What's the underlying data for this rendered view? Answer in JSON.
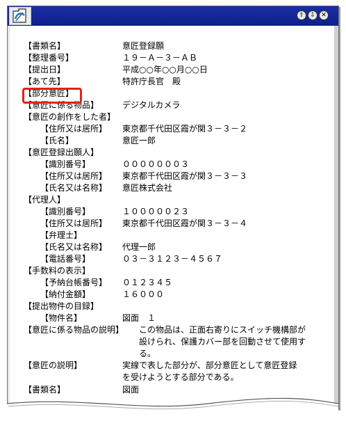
{
  "window": {
    "controls": [
      "⇧",
      "⇩",
      "✕"
    ]
  },
  "document": {
    "lines": [
      {
        "label": "【書類名】",
        "value": "意匠登録願",
        "indent": 0
      },
      {
        "label": "【整理番号】",
        "value": "１９－Ａ－３－ＡＢ",
        "indent": 0
      },
      {
        "label": "【提出日】",
        "value": "平成○○年○○月○○日",
        "indent": 0
      },
      {
        "label": "【あて先】",
        "value": "特許庁長官　殿",
        "indent": 0
      },
      {
        "label": "【部分意匠】",
        "value": "",
        "indent": 0
      },
      {
        "label": "【意匠に係る物品】",
        "value": "デジタルカメラ",
        "indent": 0
      },
      {
        "label": "【意匠の創作をした者】",
        "value": "",
        "indent": 0
      },
      {
        "label": "【住所又は居所】",
        "value": "東京都千代田区霞が関３－３－２",
        "indent": 1
      },
      {
        "label": "【氏名】",
        "value": "意匠一郎",
        "indent": 1
      },
      {
        "label": "【意匠登録出願人】",
        "value": "",
        "indent": 0
      },
      {
        "label": "【識別番号】",
        "value": "０００００００３",
        "indent": 1
      },
      {
        "label": "【住所又は居所】",
        "value": "東京都千代田区霞が関３－３－３",
        "indent": 1
      },
      {
        "label": "【氏名又は名称】",
        "value": "意匠株式会社",
        "indent": 1
      },
      {
        "label": "【代理人】",
        "value": "",
        "indent": 0
      },
      {
        "label": "【識別番号】",
        "value": "１０００００２３",
        "indent": 1
      },
      {
        "label": "【住所又は居所】",
        "value": "東京都千代田区霞が関３－３－４",
        "indent": 1
      },
      {
        "label": "【弁理士】",
        "value": "",
        "indent": 1
      },
      {
        "label": "【氏名又は名称】",
        "value": "代理一郎",
        "indent": 1
      },
      {
        "label": "【電話番号】",
        "value": "０３－３１２３－４５６７",
        "indent": 1
      },
      {
        "label": "【手数料の表示】",
        "value": "",
        "indent": 0
      },
      {
        "label": "【予納台帳番号】",
        "value": "０１２３４５",
        "indent": 1
      },
      {
        "label": "【納付金額】",
        "value": "１６０００",
        "indent": 1
      },
      {
        "label": "【提出物件の目録】",
        "value": "",
        "indent": 0
      },
      {
        "label": "【物件名】",
        "value": "図面　１",
        "indent": 1
      }
    ],
    "description_label": "【意匠に係る物品の説明】",
    "description_text": "この物品は、正面右寄りにスイッチ機構部が設けられ、保護カバー部を回動させて使用する。",
    "explanation_label": "【意匠の説明】",
    "explanation_text": "実線で表した部分が、部分意匠として意匠登録を受けようとする部分である。",
    "last_label": "【書類名】",
    "last_value": "図面"
  },
  "highlight_color": "#e2231a",
  "titlebar_color": "#0d1f8a"
}
